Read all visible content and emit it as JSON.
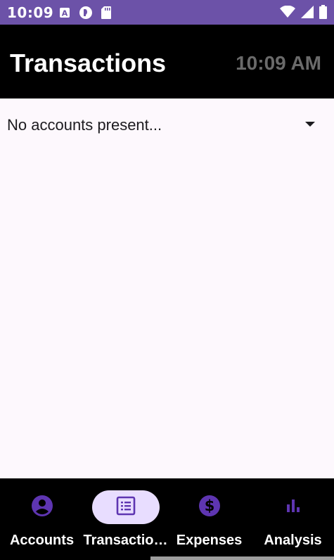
{
  "status_bar": {
    "time": "10:09",
    "icons_left": [
      "font-a-icon",
      "sync-icon",
      "sd-card-icon"
    ],
    "icons_right": [
      "wifi-icon",
      "signal-icon",
      "battery-icon"
    ]
  },
  "app_bar": {
    "title": "Transactions",
    "clock": "10:09 AM"
  },
  "account_selector": {
    "text": "No accounts present...",
    "icon": "dropdown-arrow-icon"
  },
  "bottom_nav": {
    "items": [
      {
        "label": "Accounts",
        "icon": "account-circle-icon",
        "active": false
      },
      {
        "label": "Transactio…",
        "icon": "list-icon",
        "active": true
      },
      {
        "label": "Expenses",
        "icon": "dollar-icon",
        "active": false
      },
      {
        "label": "Analysis",
        "icon": "bar-chart-icon",
        "active": false
      }
    ]
  },
  "colors": {
    "status_bar": "#6c52a8",
    "accent": "#5e35b1",
    "active_pill": "#e8ddff",
    "background": "#fdf8fd"
  }
}
